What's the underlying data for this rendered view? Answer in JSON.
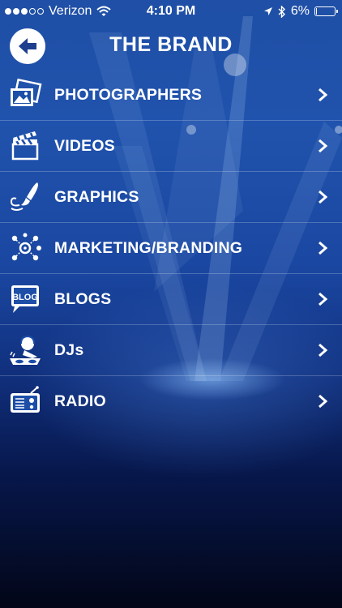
{
  "status_bar": {
    "carrier": "Verizon",
    "time": "4:10 PM",
    "battery": "6%",
    "battery_level": 0.06
  },
  "header": {
    "title": "THE BRAND"
  },
  "menu": {
    "items": [
      {
        "label": "PHOTOGRAPHERS",
        "icon": "photos-icon"
      },
      {
        "label": "VIDEOS",
        "icon": "clapperboard-icon"
      },
      {
        "label": "GRAPHICS",
        "icon": "paintbrush-icon"
      },
      {
        "label": "MARKETING/BRANDING",
        "icon": "network-icon"
      },
      {
        "label": "BLOGS",
        "icon": "blog-icon"
      },
      {
        "label": "DJs",
        "icon": "dj-icon"
      },
      {
        "label": "RADIO",
        "icon": "radio-icon"
      }
    ]
  },
  "colors": {
    "background_top": "#2053ad",
    "background_bottom": "#020617",
    "text": "#ffffff"
  }
}
